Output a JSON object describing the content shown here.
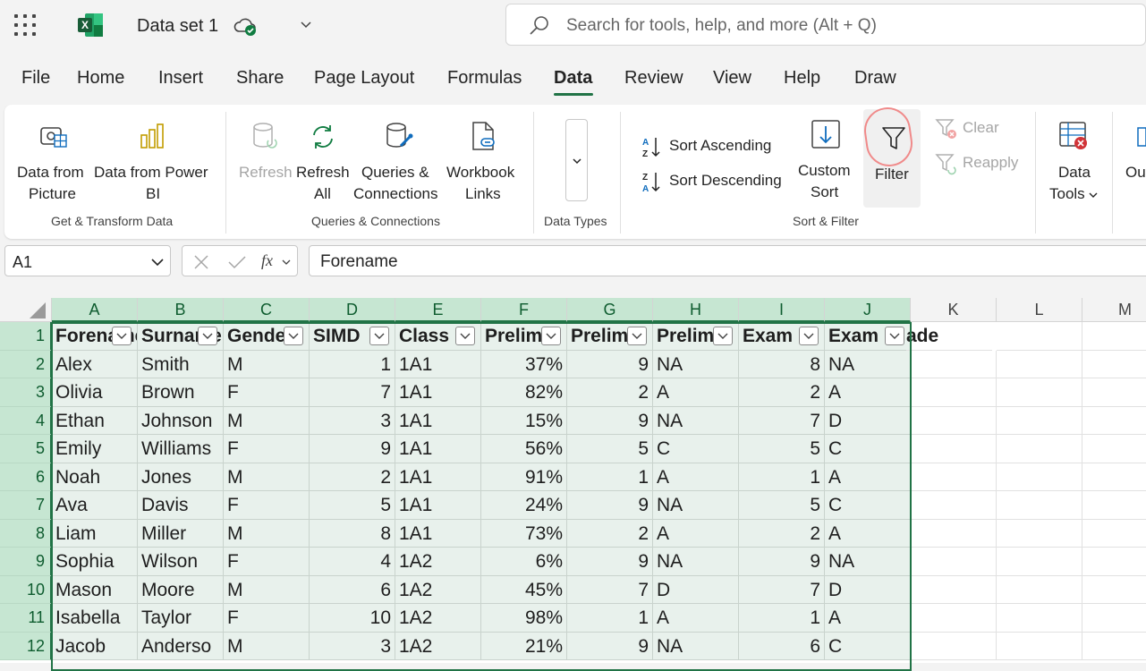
{
  "titlebar": {
    "doc_title": "Data set 1",
    "search_placeholder": "Search for tools, help, and more (Alt + Q)"
  },
  "tabs": [
    "File",
    "Home",
    "Insert",
    "Share",
    "Page Layout",
    "Formulas",
    "Data",
    "Review",
    "View",
    "Help",
    "Draw"
  ],
  "active_tab": "Data",
  "ribbon": {
    "get_transform": {
      "label": "Get & Transform Data",
      "data_from_picture": [
        "Data from",
        "Picture"
      ],
      "data_from_powerbi": [
        "Data from Power",
        "BI"
      ]
    },
    "queries": {
      "label": "Queries & Connections",
      "refresh": "Refresh",
      "refresh_all": [
        "Refresh",
        "All"
      ],
      "queries_connections": [
        "Queries &",
        "Connections"
      ],
      "workbook_links": [
        "Workbook",
        "Links"
      ]
    },
    "data_types": {
      "label": "Data Types"
    },
    "sort_filter": {
      "label": "Sort & Filter",
      "sort_ascending": "Sort Ascending",
      "sort_descending": "Sort Descending",
      "custom_sort": [
        "Custom",
        "Sort"
      ],
      "filter": "Filter",
      "clear": "Clear",
      "reapply": "Reapply"
    },
    "data_tools": [
      "Data",
      "Tools"
    ],
    "outline": "Ou"
  },
  "formula_bar": {
    "name_box": "A1",
    "fx": "fx",
    "content": "Forename"
  },
  "grid": {
    "columns": [
      "A",
      "B",
      "C",
      "D",
      "E",
      "F",
      "G",
      "H",
      "I",
      "J",
      "K",
      "L",
      "M"
    ],
    "headers": [
      "Forename",
      "Surname",
      "Gender",
      "SIMD",
      "Class",
      "Prelim",
      "Prelim",
      "Prelim",
      "Exam",
      "Exam",
      "ade"
    ],
    "rows": [
      {
        "n": "1"
      },
      {
        "n": "2",
        "v": [
          "Alex",
          "Smith",
          "M",
          "1",
          "1A1",
          "37%",
          "9",
          "NA",
          "8",
          "NA"
        ]
      },
      {
        "n": "3",
        "v": [
          "Olivia",
          "Brown",
          "F",
          "7",
          "1A1",
          "82%",
          "2",
          "A",
          "2",
          "A"
        ]
      },
      {
        "n": "4",
        "v": [
          "Ethan",
          "Johnson",
          "M",
          "3",
          "1A1",
          "15%",
          "9",
          "NA",
          "7",
          "D"
        ]
      },
      {
        "n": "5",
        "v": [
          "Emily",
          "Williams",
          "F",
          "9",
          "1A1",
          "56%",
          "5",
          "C",
          "5",
          "C"
        ]
      },
      {
        "n": "6",
        "v": [
          "Noah",
          "Jones",
          "M",
          "2",
          "1A1",
          "91%",
          "1",
          "A",
          "1",
          "A"
        ]
      },
      {
        "n": "7",
        "v": [
          "Ava",
          "Davis",
          "F",
          "5",
          "1A1",
          "24%",
          "9",
          "NA",
          "5",
          "C"
        ]
      },
      {
        "n": "8",
        "v": [
          "Liam",
          "Miller",
          "M",
          "8",
          "1A1",
          "73%",
          "2",
          "A",
          "2",
          "A"
        ]
      },
      {
        "n": "9",
        "v": [
          "Sophia",
          "Wilson",
          "F",
          "4",
          "1A2",
          "6%",
          "9",
          "NA",
          "9",
          "NA"
        ]
      },
      {
        "n": "10",
        "v": [
          "Mason",
          "Moore",
          "M",
          "6",
          "1A2",
          "45%",
          "7",
          "D",
          "7",
          "D"
        ]
      },
      {
        "n": "11",
        "v": [
          "Isabella",
          "Taylor",
          "F",
          "10",
          "1A2",
          "98%",
          "1",
          "A",
          "1",
          "A"
        ]
      },
      {
        "n": "12",
        "v": [
          "Jacob",
          "Anderso",
          "M",
          "3",
          "1A2",
          "21%",
          "9",
          "NA",
          "6",
          "C"
        ]
      }
    ]
  },
  "colors": {
    "accent": "#217346",
    "selection_fill": "#e8f1ec",
    "header_selected": "#c6e6d2"
  }
}
